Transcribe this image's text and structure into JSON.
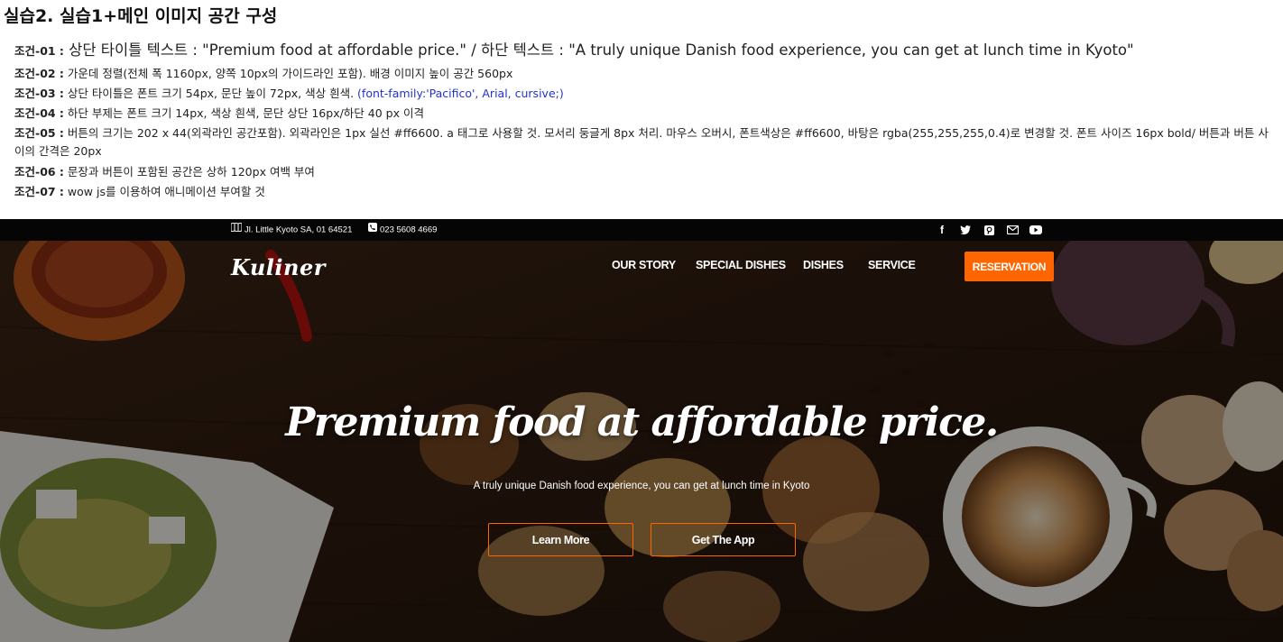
{
  "doc": {
    "title": "실습2. 실습1+메인 이미지 공간 구성",
    "conditions": [
      {
        "label": "조건-01 :",
        "text": " 상단 타이틀 텍스트 : \"Premium food at affordable price.\" / 하단 텍스트 : \"A truly unique Danish food experience, you can get at lunch time in Kyoto\""
      },
      {
        "label": "조건-02 :",
        "text": " 가운데 정렬(전체 폭 1160px, 양쪽 10px의 가이드라인 포함). 배경 이미지 높이 공간 560px"
      },
      {
        "label": "조건-03 :",
        "text": " 상단 타이틀은 폰트 크기 54px, 문단 높이 72px, 색상 흰색. ",
        "extra": "(font-family:'Pacifico', Arial, cursive;)"
      },
      {
        "label": "조건-04 :",
        "text": " 하단 부제는 폰트 크기 14px, 색상 흰색, 문단 상단 16px/하단 40 px 이격"
      },
      {
        "label": "조건-05 :",
        "text": " 버튼의 크기는 202 x 44(외곽라인 공간포함). 외곽라인은 1px 실선 #ff6600. a 태그로 사용할 것. 모서리 둥글게 8px 처리. 마우스 오버시, 폰트색상은 #ff6600, 바탕은 rgba(255,255,255,0.4)로 변경할 것. 폰트 사이즈 16px bold/ 버튼과 버튼 사이의 간격은 20px"
      },
      {
        "label": "조건-06 :",
        "text": " 문장과 버튼이 포함된 공간은 상하 120px 여백 부여"
      },
      {
        "label": "조건-07 :",
        "text": " wow js를 이용하여 애니메이션 부여할 것"
      }
    ]
  },
  "topbar": {
    "address": "Jl. Little Kyoto SA, 01 64521",
    "phone": "023 5608 4669",
    "social_icons": [
      "facebook-icon",
      "twitter-icon",
      "pinterest-icon",
      "mail-icon",
      "youtube-icon"
    ]
  },
  "header": {
    "logo": "Kuliner",
    "nav": [
      "OUR STORY",
      "SPECIAL DISHES",
      "DISHES",
      "SERVICE"
    ],
    "cta": "RESERVATION"
  },
  "hero": {
    "title": "Premium food at affordable price.",
    "subtitle": "A truly unique Danish food experience, you can get at lunch time in Kyoto",
    "buttons": [
      "Learn More",
      "Get The App"
    ]
  },
  "colors": {
    "accent": "#ff6600",
    "topbar": "#050505",
    "text_white": "#ffffff",
    "link_blue": "#2233cc"
  }
}
